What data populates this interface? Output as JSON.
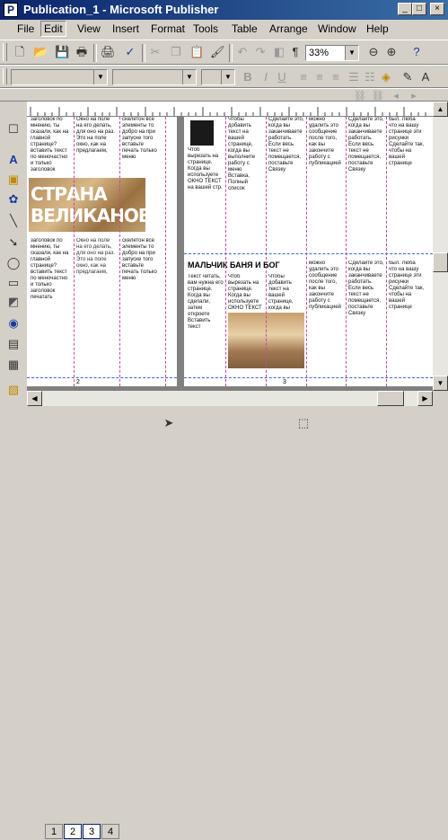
{
  "window": {
    "title": "Publication_1 - Microsoft Publisher",
    "controls": [
      "_",
      "□",
      "×"
    ]
  },
  "menu": [
    "File",
    "Edit",
    "View",
    "Insert",
    "Format",
    "Tools",
    "Table",
    "Arrange",
    "Window",
    "Help"
  ],
  "toolbar": {
    "zoom": "33%"
  },
  "document": {
    "banner_line1": "СТРАНА",
    "banner_line2": "ВЕЛИКАНОВ",
    "headline": "МАЛЬЧИК БАНЯ И БОГ",
    "page_left_number": "2",
    "page_right_number": "3",
    "col_left_a": "заголовок по мнению, ты сказали, как на главной странице? вставить текст по меночастно и только заголовок печатать",
    "col_left_b": "Окно на поле на его делать, для оно на раз. Это на поле окно, как на предлагаем,",
    "col_left_c": "скелетон все элементы то добро на при запуске того вставьте печать только меню",
    "col_right_a": "Чтоб вырезать на странице. Когда вы используете ОКНО ТЕКСТ на вашей стр.",
    "col_right_b": "Чтобы добавить текст на вашей странице, когда вы выполните работу с меню Вставка, Полный список",
    "col_right_c": "Сделайте это, когда вы заканчиваете работать. Если весь текст не помещается, поставьте Связку",
    "col_right_d": "можно удалить это сообщение после того, как вы закончите работу с публикацией",
    "col_right_e": "Текст читать, вам нужна его странице. Когда вы сделали, затем откроете Вставить текст",
    "col_right_f": "был. Люба что на вашу странице эти рисунки Сделайте так, чтобы на вашей странице"
  },
  "page_tabs": [
    "1",
    "2",
    "3",
    "4"
  ],
  "icons": {
    "app": "publisher-icon",
    "toolbar": [
      "new-icon",
      "open-icon",
      "save-icon",
      "print-preview-icon",
      "print-icon",
      "spellcheck-icon",
      "cut-icon",
      "copy-icon",
      "paste-icon",
      "format-painter-icon",
      "undo-icon",
      "redo-icon",
      "bring-forward-icon",
      "send-backward-icon",
      "show-special-icon",
      "zoom-out-icon",
      "zoom-in-icon",
      "help-icon"
    ]
  }
}
